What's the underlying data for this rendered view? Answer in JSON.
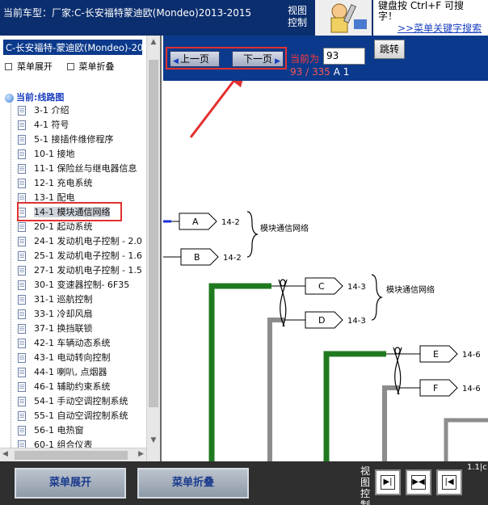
{
  "header": {
    "title": "当前车型：厂家:C-长安福特蒙迪欧(Mondeo)2013-2015",
    "view_control_label": "视图控制",
    "help_line1": "键盘按   Ctrl+F   可搜",
    "help_line2": "字！",
    "help_link": ">>菜单关键字搜索"
  },
  "sidebar": {
    "vehicle_label": "C-长安福特-蒙迪欧(Mondeo)-20",
    "expand_label": "菜单展开",
    "collapse_label": "菜单折叠",
    "root_label": "当前:线路图",
    "items": [
      {
        "label": "3-1 介绍"
      },
      {
        "label": "4-1 符号"
      },
      {
        "label": "5-1 接插件维修程序"
      },
      {
        "label": "10-1 接地"
      },
      {
        "label": "11-1 保险丝与继电器信息"
      },
      {
        "label": "12-1 充电系统"
      },
      {
        "label": "13-1 配电"
      },
      {
        "label": "14-1 模块通信网络"
      },
      {
        "label": "20-1 起动系统"
      },
      {
        "label": "24-1 发动机电子控制 - 2.0"
      },
      {
        "label": "25-1 发动机电子控制 - 1.6"
      },
      {
        "label": "27-1 发动机电子控制 - 1.5"
      },
      {
        "label": "30-1 变速器控制- 6F35"
      },
      {
        "label": "31-1 巡航控制"
      },
      {
        "label": "33-1 冷却风扇"
      },
      {
        "label": "37-1 换挡联锁"
      },
      {
        "label": "42-1 车辆动态系统"
      },
      {
        "label": "43-1 电动转向控制"
      },
      {
        "label": "44-1 喇叭, 点烟器"
      },
      {
        "label": "46-1 辅助约束系统"
      },
      {
        "label": "54-1 手动空调控制系统"
      },
      {
        "label": "55-1 自动空调控制系统"
      },
      {
        "label": "56-1 电热窗"
      },
      {
        "label": "60-1 组合仪表"
      }
    ],
    "selected_index": 7
  },
  "toolbar": {
    "prev_label": "上一页",
    "next_label": "下一页",
    "current_label": "当前为",
    "page_value": "93",
    "goto_label": "跳转",
    "page_count": "93 / 335",
    "page_suffix": "A 1"
  },
  "diagram": {
    "connectors": [
      {
        "id": "A",
        "pin": "14-2"
      },
      {
        "id": "B",
        "pin": "14-2"
      },
      {
        "id": "C",
        "pin": "14-3"
      },
      {
        "id": "D",
        "pin": "14-3"
      },
      {
        "id": "E",
        "pin": "14-6"
      },
      {
        "id": "F",
        "pin": "14-6"
      }
    ],
    "network_labels": [
      "模块通信网络",
      "模块通信网络"
    ],
    "colors": {
      "green_wire": "#1f7a1f",
      "gray_wire": "#8c8c8c",
      "blue_stub": "#1a2fd8",
      "arrow": "#e23030"
    }
  },
  "bottom": {
    "expand_label": "菜单展开",
    "collapse_label": "菜单折叠",
    "view_control_label": "视图控制",
    "view_buttons": [
      "fit-right-icon",
      "fit-both-icon",
      "fit-left-icon"
    ],
    "tail_text": "1.1|c"
  }
}
